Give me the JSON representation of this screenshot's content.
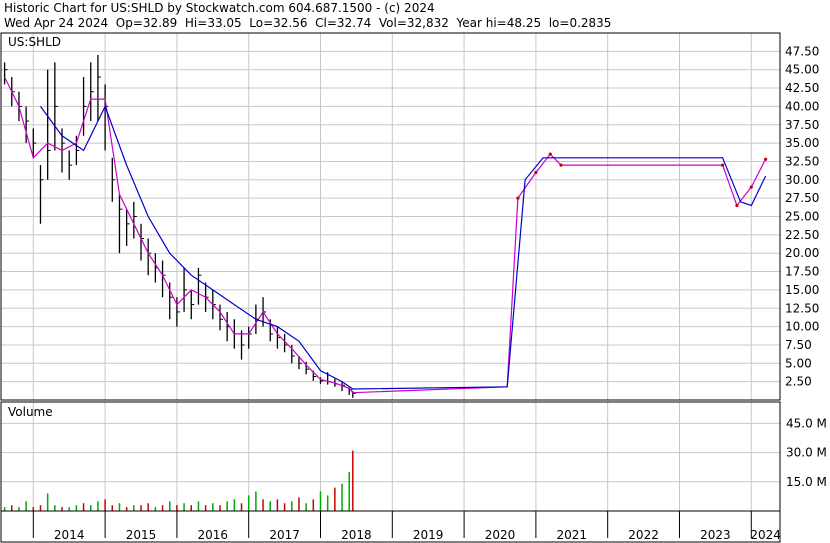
{
  "header": {
    "line1": "Historic Chart for US:SHLD by Stockwatch.com 604.687.1500 - (c) 2024",
    "line2": "Wed Apr 24 2024  Op=32.89  Hi=33.05  Lo=32.56  Cl=32.74  Vol=32,832  Year hi=48.25  lo=0.2835"
  },
  "price_panel": {
    "label": "US:SHLD"
  },
  "volume_panel": {
    "label": "Volume"
  },
  "colors": {
    "price_bar": "#000000",
    "ma_short": "#cc00cc",
    "ma_long": "#0000cc",
    "point_marker": "#cc0000",
    "volume_up": "#00aa00",
    "volume_down": "#cc0000",
    "grid": "#c8c8c8"
  },
  "chart_data": [
    {
      "type": "line",
      "title": "Historic Chart for US:SHLD",
      "ylabel": "",
      "xlabel": "",
      "ylim": [
        0,
        50
      ],
      "x_ticks": [
        "2014",
        "2015",
        "2016",
        "2017",
        "2018",
        "2019",
        "2020",
        "2021",
        "2022",
        "2023",
        "2024"
      ],
      "y_ticks": [
        "2.50",
        "5.00",
        "7.50",
        "10.00",
        "12.50",
        "15.00",
        "17.50",
        "20.00",
        "22.50",
        "25.00",
        "27.50",
        "30.00",
        "32.50",
        "35.00",
        "37.50",
        "40.00",
        "42.50",
        "45.00",
        "47.50"
      ],
      "grid": true,
      "series": [
        {
          "name": "price",
          "style": "bars",
          "x": [
            2013.6,
            2013.7,
            2013.8,
            2013.9,
            2014.0,
            2014.1,
            2014.2,
            2014.3,
            2014.4,
            2014.5,
            2014.6,
            2014.7,
            2014.8,
            2014.9,
            2015.0,
            2015.1,
            2015.2,
            2015.3,
            2015.4,
            2015.5,
            2015.6,
            2015.7,
            2015.8,
            2015.9,
            2016.0,
            2016.1,
            2016.2,
            2016.3,
            2016.4,
            2016.5,
            2016.6,
            2016.7,
            2016.8,
            2016.9,
            2017.0,
            2017.1,
            2017.2,
            2017.3,
            2017.4,
            2017.5,
            2017.6,
            2017.7,
            2017.8,
            2017.9,
            2018.0,
            2018.1,
            2018.2,
            2018.3,
            2018.4,
            2018.45
          ],
          "y": [
            45,
            42,
            40,
            38,
            35,
            30,
            34,
            40,
            35,
            32,
            34,
            40,
            42,
            44,
            40,
            30,
            26,
            24,
            25,
            22,
            20,
            18,
            17,
            14,
            12,
            15,
            13,
            17,
            14,
            13,
            11,
            10,
            9,
            7.5,
            9,
            11,
            12,
            9,
            8.5,
            7.5,
            6,
            5,
            4.2,
            3.2,
            2.6,
            2.5,
            2.2,
            2.0,
            1.4,
            0.9
          ],
          "high": [
            46,
            44,
            42,
            40,
            37,
            32,
            45,
            46,
            37,
            34,
            36,
            44,
            46,
            47,
            43,
            33,
            28,
            26,
            27,
            24,
            22,
            20,
            19,
            16,
            14,
            18,
            15,
            18,
            16,
            15,
            13,
            12,
            11,
            9.5,
            10,
            13,
            14,
            11,
            10,
            9,
            7.5,
            6,
            5.2,
            4,
            3.1,
            3.8,
            2.9,
            2.4,
            1.7,
            1.2
          ],
          "low": [
            43,
            40,
            38,
            35,
            33,
            24,
            30,
            34,
            31,
            30,
            32,
            36,
            38,
            38,
            34,
            27,
            20,
            21,
            22,
            19,
            17,
            16,
            14,
            11,
            10,
            12,
            11,
            13,
            12,
            11,
            9.5,
            8,
            7,
            5.5,
            7,
            9,
            10,
            8,
            7,
            6.5,
            5,
            4.2,
            3.5,
            2.6,
            2.2,
            2.1,
            1.8,
            1.2,
            0.7,
            0.3
          ]
        },
        {
          "name": "ma_short",
          "style": "line",
          "x": [
            2013.6,
            2013.8,
            2014.0,
            2014.2,
            2014.4,
            2014.6,
            2014.8,
            2015.0,
            2015.2,
            2015.4,
            2015.6,
            2015.8,
            2016.0,
            2016.2,
            2016.4,
            2016.6,
            2016.8,
            2017.0,
            2017.2,
            2017.4,
            2017.6,
            2017.8,
            2018.0,
            2018.2,
            2018.4,
            2018.45,
            2020.6,
            2020.75,
            2021.0,
            2021.2,
            2021.35,
            2023.6,
            2023.8,
            2024.0,
            2024.2
          ],
          "y": [
            44,
            40,
            33,
            35,
            34,
            35,
            41,
            41,
            28,
            24,
            20,
            17,
            13,
            15,
            14,
            12,
            9,
            9,
            12,
            9,
            7,
            4.8,
            2.8,
            2.3,
            1.6,
            1.0,
            1.8,
            27.5,
            31,
            33.5,
            32,
            32,
            26.5,
            29,
            32.8
          ]
        },
        {
          "name": "ma_long",
          "style": "line",
          "x": [
            2014.1,
            2014.4,
            2014.7,
            2015.0,
            2015.3,
            2015.6,
            2015.9,
            2016.2,
            2016.5,
            2016.8,
            2017.1,
            2017.4,
            2017.7,
            2018.0,
            2018.3,
            2018.45,
            2020.6,
            2020.85,
            2021.1,
            2021.35,
            2023.6,
            2023.85,
            2024.0,
            2024.2
          ],
          "y": [
            40,
            36,
            34,
            40,
            32,
            25,
            20,
            17,
            15,
            13,
            11,
            10,
            8,
            4,
            2.5,
            1.5,
            1.8,
            30,
            33,
            33,
            33,
            27,
            26.5,
            30.5
          ]
        }
      ]
    },
    {
      "type": "bar",
      "title": "Volume",
      "ylabel": "",
      "y_ticks": [
        "15.0 M",
        "30.0 M",
        "45.0 M"
      ],
      "ylim": [
        0,
        56
      ],
      "series": [
        {
          "name": "volume",
          "x": [
            2013.6,
            2013.7,
            2013.8,
            2013.9,
            2014.0,
            2014.1,
            2014.2,
            2014.3,
            2014.4,
            2014.5,
            2014.6,
            2014.7,
            2014.8,
            2014.9,
            2015.0,
            2015.1,
            2015.2,
            2015.3,
            2015.4,
            2015.5,
            2015.6,
            2015.7,
            2015.8,
            2015.9,
            2016.0,
            2016.1,
            2016.2,
            2016.3,
            2016.4,
            2016.5,
            2016.6,
            2016.7,
            2016.8,
            2016.9,
            2017.0,
            2017.1,
            2017.2,
            2017.3,
            2017.4,
            2017.5,
            2017.6,
            2017.7,
            2017.8,
            2017.9,
            2018.0,
            2018.1,
            2018.2,
            2018.3,
            2018.4,
            2018.45
          ],
          "values": [
            2,
            3,
            2,
            5,
            2,
            3,
            9,
            3,
            2,
            2,
            3,
            4,
            3,
            5,
            6,
            3,
            4,
            2,
            3,
            3,
            4,
            2,
            3,
            5,
            3,
            4,
            3,
            5,
            3,
            4,
            3,
            5,
            6,
            4,
            8,
            10,
            6,
            5,
            6,
            4,
            5,
            7,
            4,
            6,
            10,
            8,
            12,
            14,
            20,
            31
          ],
          "up": [
            true,
            false,
            true,
            true,
            false,
            false,
            true,
            true,
            false,
            true,
            true,
            false,
            true,
            true,
            false,
            false,
            true,
            false,
            true,
            false,
            false,
            true,
            false,
            true,
            false,
            true,
            false,
            true,
            false,
            true,
            false,
            true,
            true,
            false,
            true,
            true,
            false,
            true,
            false,
            false,
            true,
            false,
            true,
            false,
            true,
            true,
            false,
            true,
            true,
            false
          ]
        }
      ]
    }
  ]
}
